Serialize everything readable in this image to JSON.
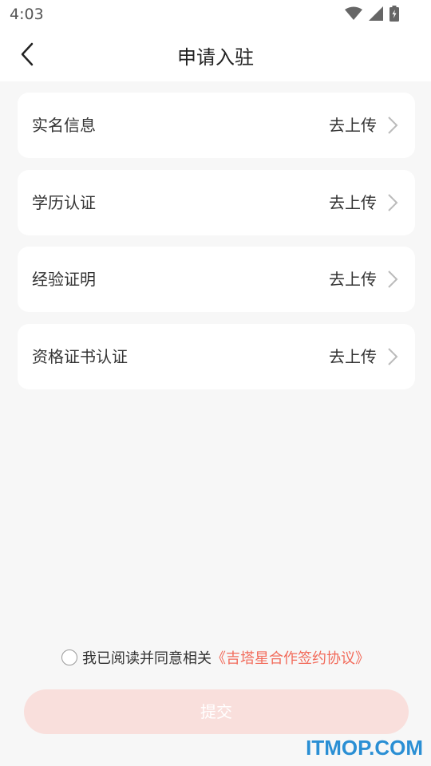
{
  "status": {
    "time": "4:03"
  },
  "header": {
    "title": "申请入驻"
  },
  "items": [
    {
      "label": "实名信息",
      "action": "去上传"
    },
    {
      "label": "学历认证",
      "action": "去上传"
    },
    {
      "label": "经验证明",
      "action": "去上传"
    },
    {
      "label": "资格证书认证",
      "action": "去上传"
    }
  ],
  "agreement": {
    "text": "我已阅读并同意相关",
    "link": "《吉塔星合作签约协议》"
  },
  "submit": {
    "label": "提交"
  },
  "colors": {
    "accent": "#f26b5b",
    "submit_bg": "#f9dfdc",
    "watermark": "#2a8fd4"
  },
  "watermark": "ITMOP.COM"
}
